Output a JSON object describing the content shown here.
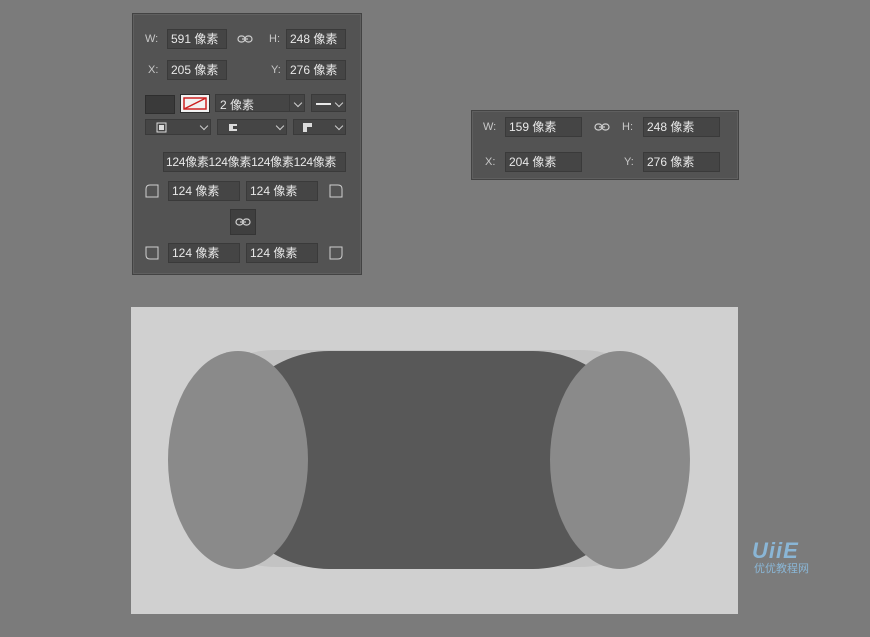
{
  "shape_panel": {
    "w_label": "W:",
    "w_value": "591 像素",
    "h_label": "H:",
    "h_value": "248 像素",
    "x_label": "X:",
    "x_value": "205 像素",
    "y_label": "Y:",
    "y_value": "276 像素",
    "stroke_width": "2 像素",
    "corner_all": [
      "124像素",
      "124像素",
      "124像素",
      "124像素"
    ],
    "corner_top_left": "124 像素",
    "corner_top_right": "124 像素",
    "corner_bottom_left": "124 像素",
    "corner_bottom_right": "124 像素"
  },
  "ellipse_panel": {
    "w_label": "W:",
    "w_value": "159 像素",
    "h_label": "H:",
    "h_value": "248 像素",
    "x_label": "X:",
    "x_value": "204 像素",
    "y_label": "Y:",
    "y_value": "276 像素"
  },
  "watermark": {
    "logo_text": "UiiE",
    "site_text": "优优教程网"
  },
  "colors": {
    "fill_swatch": "#3a3a3a",
    "stroke_red": "#cc2222",
    "capsule_body": "#585858",
    "ellipse_fill": "#8a8a8a",
    "canvas_bg": "#d0d0d0"
  },
  "icons": {
    "link": "link-icon",
    "chevron": "chevron-down-icon",
    "corner": "corner-radius-icon"
  }
}
